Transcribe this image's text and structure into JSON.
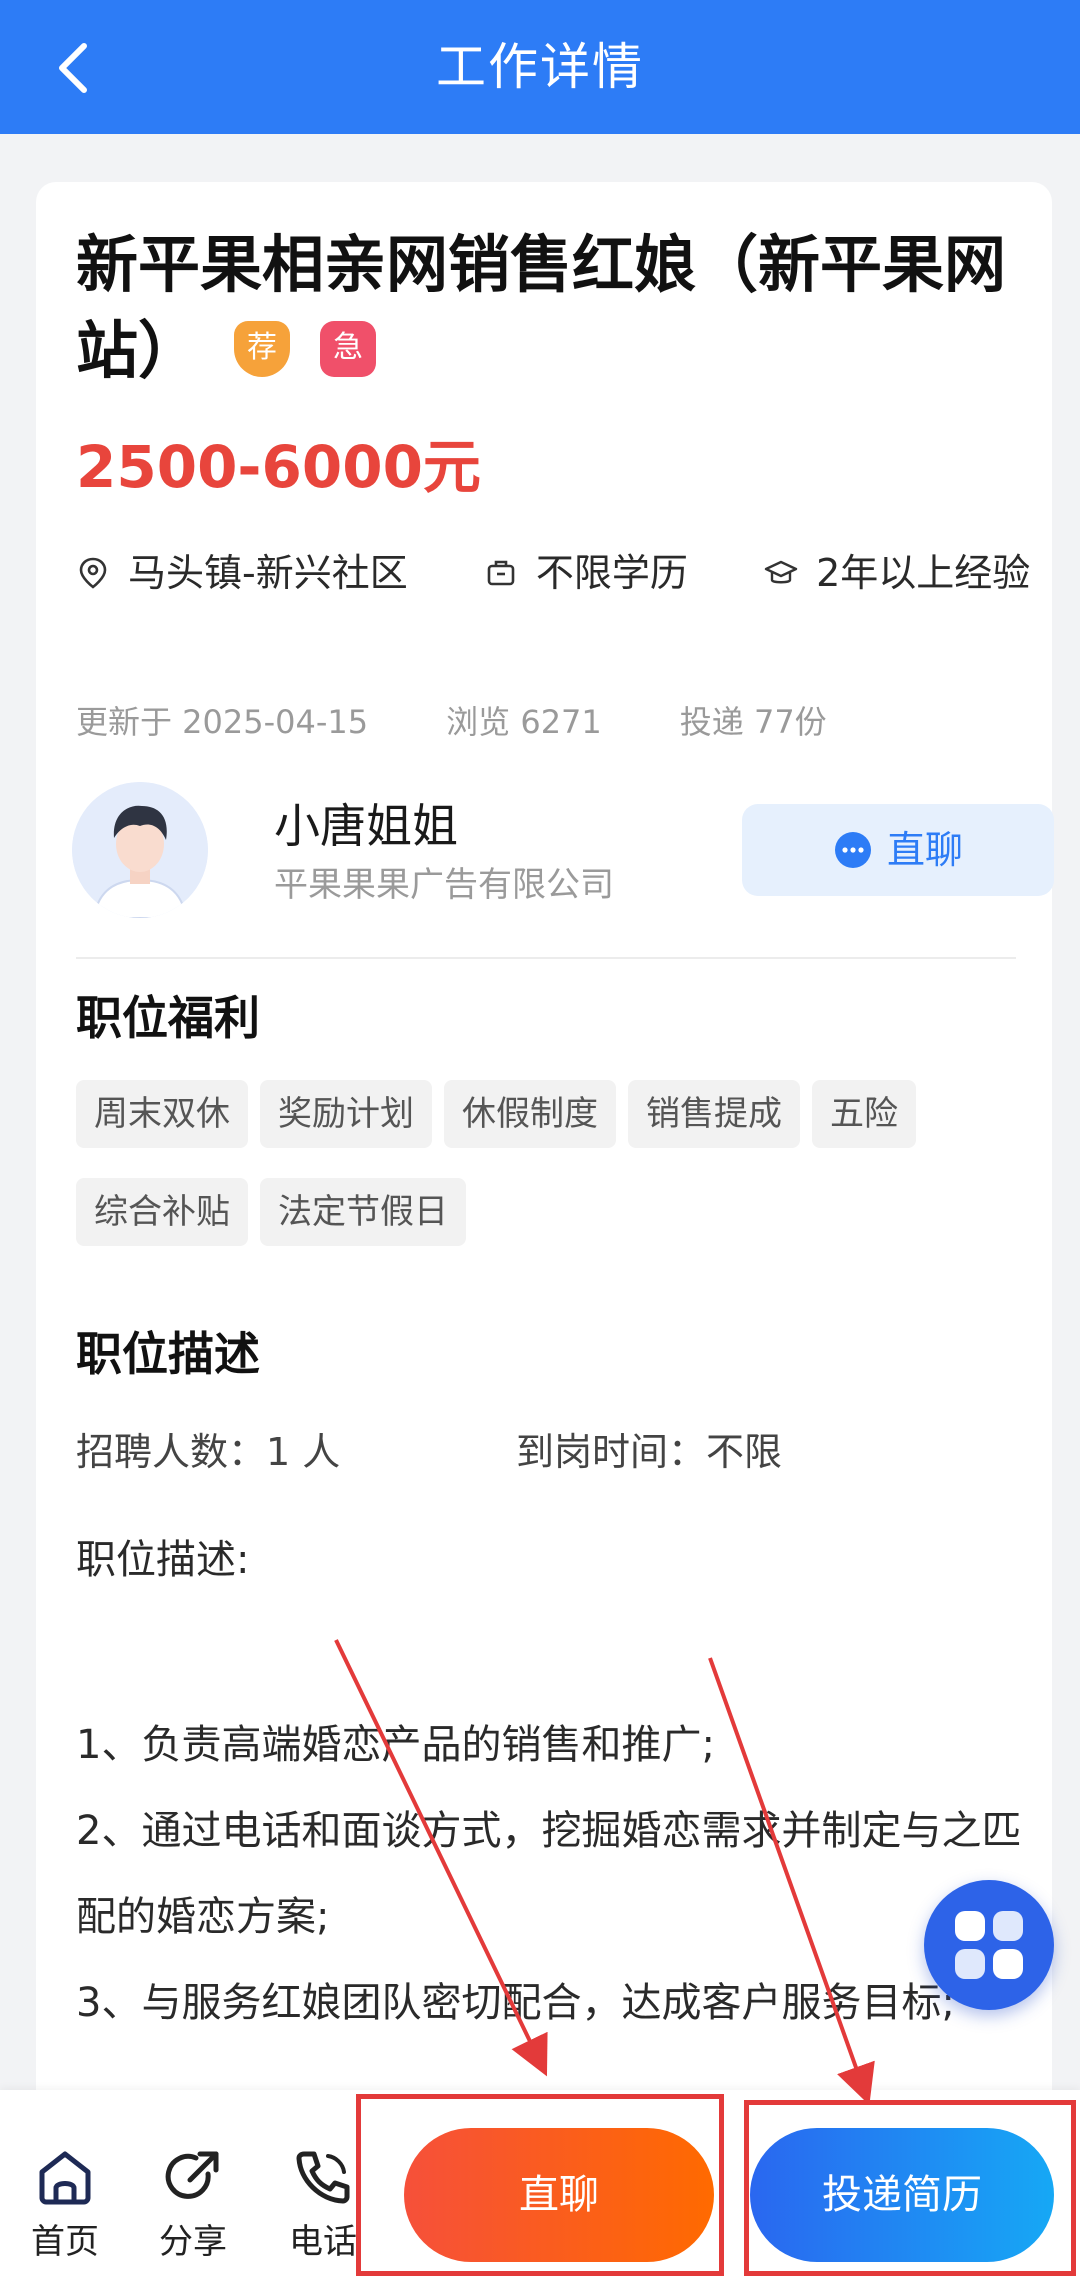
{
  "header": {
    "title": "工作详情"
  },
  "job": {
    "title": "新平果相亲网销售红娘（新平果网站）",
    "badge_recommend": "荐",
    "badge_urgent": "急",
    "salary": "2500-6000元",
    "location": "马头镇-新兴社区",
    "education": "不限学历",
    "experience": "2年以上经验",
    "updated": "更新于 2025-04-15",
    "views": "浏览 6271",
    "applications": "投递 77份"
  },
  "recruiter": {
    "name": "小唐姐姐",
    "company": "平果果果广告有限公司",
    "chat_label": "直聊"
  },
  "benefits": {
    "title": "职位福利",
    "tags": [
      "周末双休",
      "奖励计划",
      "休假制度",
      "销售提成",
      "五险",
      "综合补贴",
      "法定节假日"
    ]
  },
  "description": {
    "title": "职位描述",
    "headcount": "招聘人数：1 人",
    "start_time": "到岗时间：不限",
    "label": "职位描述:",
    "lines": [
      "1、负责高端婚恋产品的销售和推广;",
      "2、通过电话和面谈方式，挖掘婚恋需求并制定与之匹配的婚恋方案;",
      "3、与服务红娘团队密切配合，达成客户服务目标;"
    ]
  },
  "bottom_bar": {
    "home": "首页",
    "share": "分享",
    "phone": "电话",
    "chat": "直聊",
    "apply": "投递简历"
  },
  "colors": {
    "brand_blue": "#2d7cf6",
    "salary_red": "#e8453c",
    "chat_orange": "#ff6a00",
    "apply_blue": "#2a67f0",
    "annotation_red": "#e33a3a"
  }
}
